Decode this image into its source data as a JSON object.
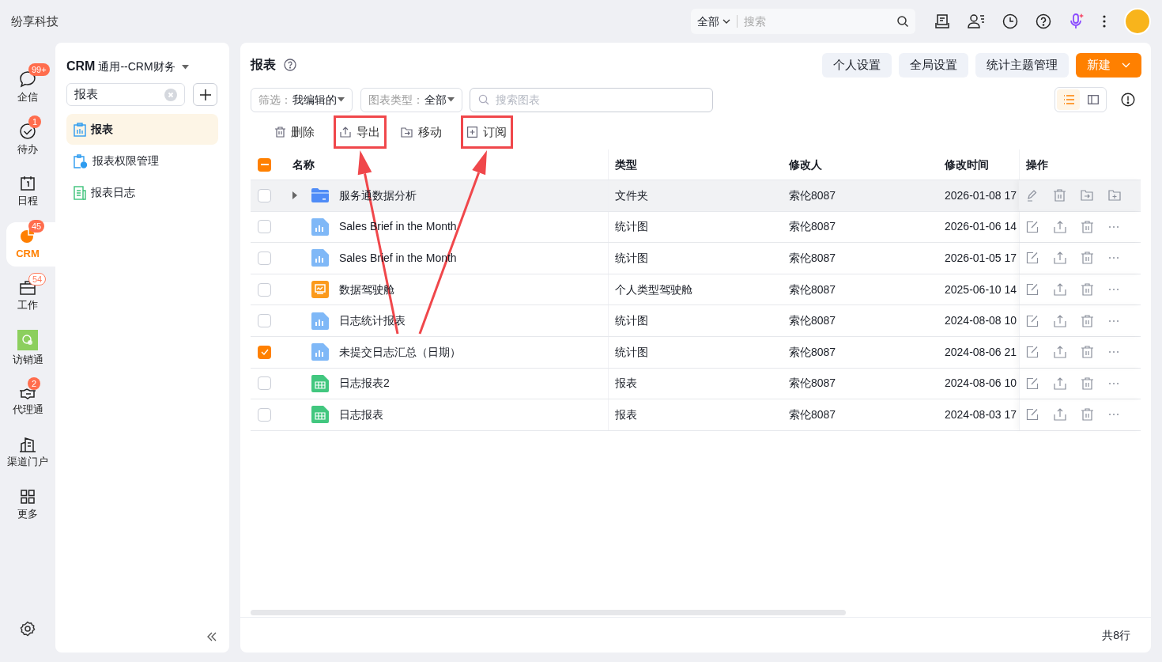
{
  "app": {
    "title": "纷享科技"
  },
  "top_search": {
    "scope": "全部",
    "placeholder": "搜索"
  },
  "nav": [
    {
      "label": "企信",
      "badge": "99+",
      "badge_outlined": false,
      "selected": false
    },
    {
      "label": "待办",
      "badge": "1",
      "badge_outlined": false,
      "selected": false
    },
    {
      "label": "日程",
      "selected": false
    },
    {
      "label": "CRM",
      "badge": "45",
      "badge_outlined": false,
      "selected": true
    },
    {
      "label": "工作",
      "badge": "54",
      "badge_outlined": true,
      "selected": false
    },
    {
      "label": "访销通",
      "selected": false
    },
    {
      "label": "代理通",
      "badge": "2",
      "badge_outlined": false,
      "selected": false
    },
    {
      "label": "渠道门户",
      "selected": false
    },
    {
      "label": "更多",
      "selected": false
    }
  ],
  "sidebar": {
    "app": "CRM",
    "workspace": "通用--CRM财务",
    "search": {
      "value": "报表"
    },
    "items": [
      {
        "label": "报表",
        "selected": true
      },
      {
        "label": "报表权限管理",
        "selected": false
      },
      {
        "label": "报表日志",
        "selected": false
      }
    ]
  },
  "main": {
    "title": "报表",
    "header_buttons": [
      {
        "label": "个人设置",
        "kind": "secondary"
      },
      {
        "label": "全局设置",
        "kind": "secondary"
      },
      {
        "label": "统计主题管理",
        "kind": "secondary"
      },
      {
        "label": "新建",
        "kind": "primary"
      }
    ],
    "filters": [
      {
        "label": "筛选：",
        "value": "我编辑的"
      },
      {
        "label": "图表类型：",
        "value": "全部"
      }
    ],
    "search": {
      "placeholder": "搜索图表"
    },
    "view_modes": [
      {
        "selected": true
      },
      {
        "selected": false
      }
    ],
    "toolbar": [
      {
        "label": "删除",
        "highlighted": false
      },
      {
        "label": "导出",
        "highlighted": true
      },
      {
        "label": "移动",
        "highlighted": false
      },
      {
        "label": "订阅",
        "highlighted": true
      }
    ],
    "table": {
      "select_all": {
        "indeterminate": true
      },
      "columns": [
        "名称",
        "类型",
        "修改人",
        "修改时间",
        "操作"
      ],
      "rows": [
        {
          "kind": "folder",
          "name": "服务通数据分析",
          "type": "文件夹",
          "modifier": "索伦8087",
          "modified": "2026-01-08 17",
          "checked": false,
          "hovered": true
        },
        {
          "kind": "chart",
          "name": "Sales Brief in the Month",
          "type": "统计图",
          "modifier": "索伦8087",
          "modified": "2026-01-06 14",
          "checked": false,
          "hovered": false
        },
        {
          "kind": "chart",
          "name": "Sales Brief in the Month",
          "type": "统计图",
          "modifier": "索伦8087",
          "modified": "2026-01-05 17",
          "checked": false,
          "hovered": false
        },
        {
          "kind": "dashboard",
          "name": "数据驾驶舱",
          "type": "个人类型驾驶舱",
          "modifier": "索伦8087",
          "modified": "2025-06-10 14",
          "checked": false,
          "hovered": false
        },
        {
          "kind": "chart",
          "name": "日志统计报表",
          "type": "统计图",
          "modifier": "索伦8087",
          "modified": "2024-08-08 10",
          "checked": false,
          "hovered": false
        },
        {
          "kind": "chart",
          "name": "未提交日志汇总（日期）",
          "type": "统计图",
          "modifier": "索伦8087",
          "modified": "2024-08-06 21",
          "checked": true,
          "hovered": false
        },
        {
          "kind": "report",
          "name": "日志报表2",
          "type": "报表",
          "modifier": "索伦8087",
          "modified": "2024-08-06 10",
          "checked": false,
          "hovered": false
        },
        {
          "kind": "report",
          "name": "日志报表",
          "type": "报表",
          "modifier": "索伦8087",
          "modified": "2024-08-03 17",
          "checked": false,
          "hovered": false
        }
      ]
    },
    "footer": {
      "total": "共8行"
    }
  },
  "annotations": {
    "arrows_to_highlights": true
  }
}
